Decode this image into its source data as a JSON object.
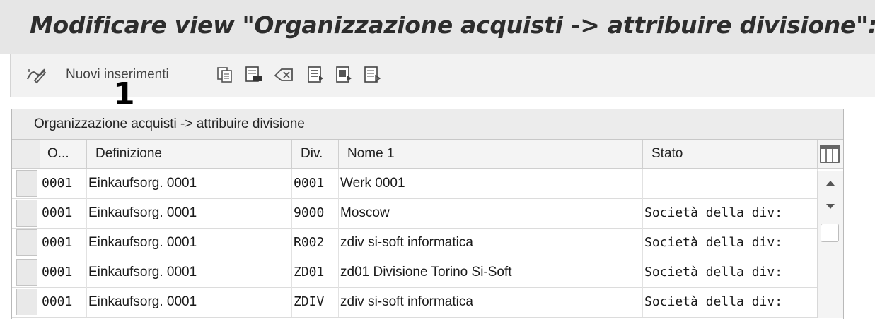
{
  "window": {
    "title": "Modificare view \"Organizzazione acquisti -> attribuire divisione\": rie"
  },
  "toolbar": {
    "items": [
      {
        "icon": "toggle-change-display-icon"
      },
      {
        "label": "Nuovi inserimenti",
        "icon": "new-entries"
      },
      {
        "icon": "copy-as-icon"
      },
      {
        "icon": "delete-icon"
      },
      {
        "icon": "undo-change-icon"
      },
      {
        "icon": "select-all-icon"
      },
      {
        "icon": "select-block-icon"
      },
      {
        "icon": "deselect-all-icon"
      }
    ]
  },
  "annotation": {
    "number": "1"
  },
  "table": {
    "caption": "Organizzazione acquisti -> attribuire divisione",
    "columns": [
      "O...",
      "Definizione",
      "Div.",
      "Nome 1",
      "Stato"
    ],
    "rows": [
      {
        "org": "0001",
        "definition": "Einkaufsorg. 0001",
        "plant": "0001",
        "name": "Werk 0001",
        "status": ""
      },
      {
        "org": "0001",
        "definition": "Einkaufsorg. 0001",
        "plant": "9000",
        "name": "Moscow",
        "status": "Società della div:"
      },
      {
        "org": "0001",
        "definition": "Einkaufsorg. 0001",
        "plant": "R002",
        "name": "zdiv si-soft informatica",
        "status": "Società della div:"
      },
      {
        "org": "0001",
        "definition": "Einkaufsorg. 0001",
        "plant": "ZD01",
        "name": "zd01 Divisione Torino Si-Soft",
        "status": "Società della div:"
      },
      {
        "org": "0001",
        "definition": "Einkaufsorg. 0001",
        "plant": "ZDIV",
        "name": "zdiv si-soft informatica",
        "status": "Società della div:"
      }
    ]
  },
  "colors": {
    "title_bg": "#e6e6e6",
    "toolbar_bg": "#f2f2f2",
    "grid_header_bg": "#f4f4f4",
    "text": "#1a1a1a"
  }
}
